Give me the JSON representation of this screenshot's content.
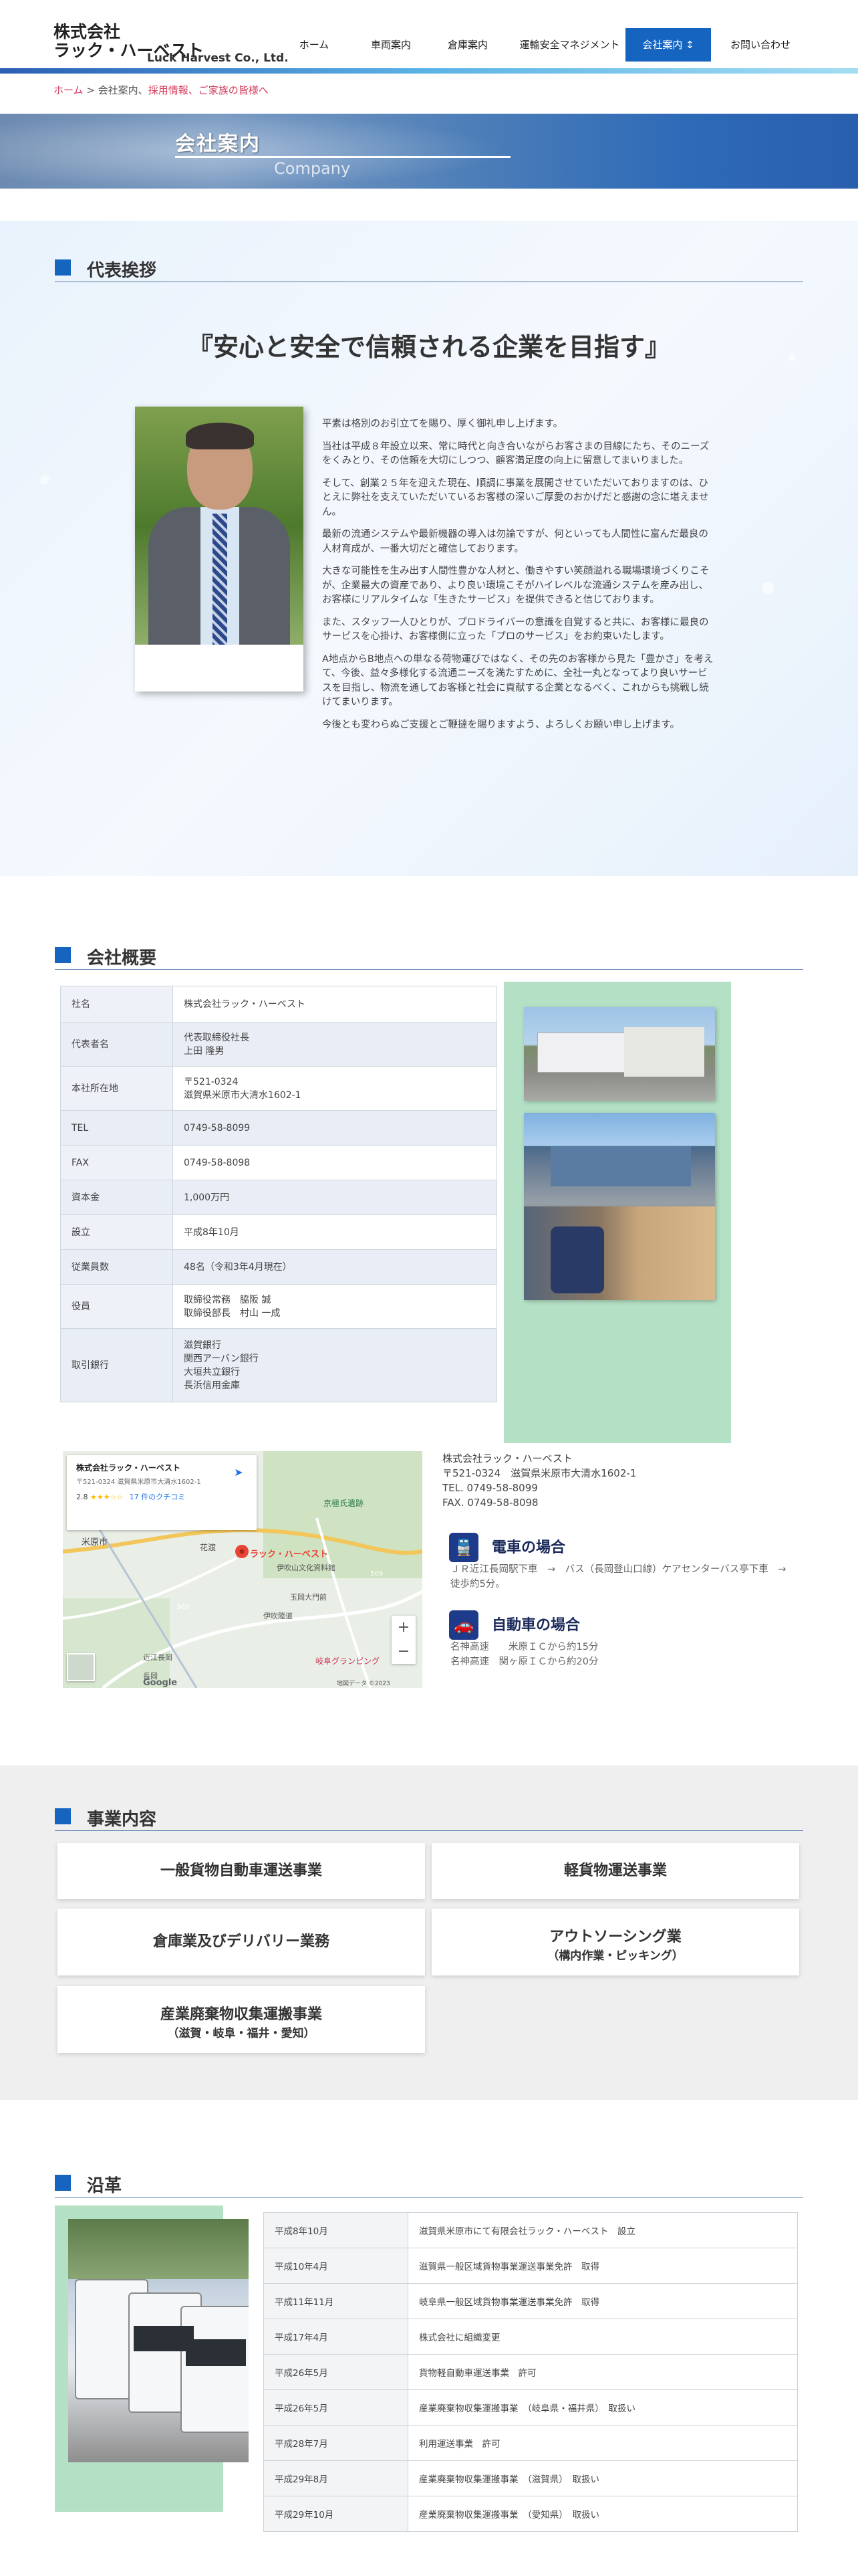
{
  "header": {
    "logo_line1": "株式会社",
    "logo_line2": "ラック・ハーベスト",
    "logo_en": "Luck Harvest Co., Ltd.",
    "nav": [
      {
        "label": "ホーム"
      },
      {
        "label": "車両案内"
      },
      {
        "label": "倉庫案内"
      },
      {
        "label": "運輸安全マネジメント"
      },
      {
        "label": "会社案内 ↕",
        "active": true
      },
      {
        "label": "お問い合わせ"
      }
    ]
  },
  "breadcrumb": {
    "home": "ホーム",
    "sep": " > ",
    "current": "会社案内、",
    "links": "採用情報、ご家族の皆様へ"
  },
  "hero": {
    "title": "会社案内",
    "subtitle": "Company"
  },
  "greeting": {
    "section_title": "代表挨拶",
    "motto": "『安心と安全で信頼される企業を目指す』",
    "paragraphs": [
      "平素は格別のお引立てを賜り、厚く御礼申し上げます。",
      "当社は平成８年設立以来、常に時代と向き合いながらお客さまの目線にたち、そのニーズをくみとり、その信頼を大切にしつつ、顧客満足度の向上に留意してまいりました。",
      "そして、創業２５年を迎えた現在、順調に事業を展開させていただいておりますのは、ひとえに弊社を支えていただいているお客様の深いご厚愛のおかげだと感謝の念に堪えません。",
      "最新の流通システムや最新機器の導入は勿論ですが、何といっても人間性に富んだ最良の人材育成が、一番大切だと確信しております。",
      "大きな可能性を生み出す人間性豊かな人材と、働きやすい笑顔溢れる職場環境づくりこそが、企業最大の資産であり、より良い環境こそがハイレベルな流通システムを産み出し、お客様にリアルタイムな「生きたサービス」を提供できると信じております。",
      "また、スタッフ一人ひとりが、プロドライバーの意識を自覚すると共に、お客様に最良のサービスを心掛け、お客様側に立った「プロのサービス」をお約束いたします。",
      "A地点からB地点への単なる荷物運びではなく、その先のお客様から見た「豊かさ」を考えて、今後、益々多様化する流通ニーズを満たすために、全社一丸となってより良いサービスを目指し、物流を通してお客様と社会に貢献する企業となるべく、これからも挑戦し続けてまいります。",
      "今後とも変わらぬご支援とご鞭撻を賜りますよう、よろしくお願い申し上げます。"
    ]
  },
  "company": {
    "section_title": "会社概要",
    "rows": [
      {
        "k": "社名",
        "v": [
          "株式会社ラック・ハーベスト"
        ]
      },
      {
        "k": "代表者名",
        "v": [
          "代表取締役社長",
          "上田 隆男"
        ]
      },
      {
        "k": "本社所在地",
        "v": [
          "〒521-0324",
          "滋賀県米原市大清水1602-1"
        ]
      },
      {
        "k": "TEL",
        "v": [
          "0749-58-8099"
        ]
      },
      {
        "k": "FAX",
        "v": [
          "0749-58-8098"
        ]
      },
      {
        "k": "資本金",
        "v": [
          "1,000万円"
        ]
      },
      {
        "k": "設立",
        "v": [
          "平成8年10月"
        ]
      },
      {
        "k": "従業員数",
        "v": [
          "48名（令和3年4月現在）"
        ]
      },
      {
        "k": "役員",
        "v": [
          "取締役常務　脇阪 誠",
          "取締役部長　村山 一成"
        ]
      },
      {
        "k": "取引銀行",
        "v": [
          "滋賀銀行",
          "関西アーバン銀行",
          "大垣共立銀行",
          "長浜信用金庫"
        ]
      }
    ],
    "address_lines": [
      "株式会社ラック・ハーベスト",
      "〒521-0324　滋賀県米原市大清水1602-1",
      "TEL. 0749-58-8099",
      "FAX. 0749-58-8098"
    ],
    "access": [
      {
        "icon": "train-icon",
        "title": "電車の場合",
        "desc": [
          "ＪＲ近江長岡駅下車　→　バス（長岡登山口線）ケアセンターバス亭下車　→　徒歩約5分。"
        ]
      },
      {
        "icon": "car-icon",
        "title": "自動車の場合",
        "desc": [
          "名神高速　　米原ＩＣから約15分",
          "名神高速　関ヶ原ＩＣから約20分"
        ]
      }
    ],
    "map": {
      "place_name": "株式会社ラック・ハーベスト",
      "place_addr": "〒521-0324 滋賀県米原市大清水1602-1",
      "rating": "2.8",
      "stars": "★★★☆☆",
      "reviews": "17 件のクチコミ",
      "marker_label": "ラック・ハーベスト",
      "labels": [
        "米原市",
        "花渡",
        "京極氏遺跡",
        "伊吹山文化資料館",
        "玉岡大門前",
        "伊吹陸道",
        "近江長岡",
        "岐阜グランピング",
        "長岡"
      ],
      "route_labels": [
        "365",
        "509"
      ],
      "google": "Google",
      "footer": "地図データ ©2023"
    }
  },
  "business": {
    "section_title": "事業内容",
    "items": [
      {
        "main": "一般貨物自動車運送事業",
        "sub": ""
      },
      {
        "main": "軽貨物運送事業",
        "sub": ""
      },
      {
        "main": "倉庫業及びデリバリー業務",
        "sub": ""
      },
      {
        "main": "アウトソーシング業",
        "sub": "（構内作業・ピッキング）"
      },
      {
        "main": "産業廃棄物収集運搬事業",
        "sub": "（滋賀・岐阜・福井・愛知）"
      }
    ]
  },
  "history": {
    "section_title": "沿革",
    "rows": [
      {
        "k": "平成8年10月",
        "v": "滋賀県米原市にて有限会社ラック・ハーベスト　設立"
      },
      {
        "k": "平成10年4月",
        "v": "滋賀県一般区域貨物事業運送事業免許　取得"
      },
      {
        "k": "平成11年11月",
        "v": "岐阜県一般区域貨物事業運送事業免許　取得"
      },
      {
        "k": "平成17年4月",
        "v": "株式会社に組織変更"
      },
      {
        "k": "平成26年5月",
        "v": "貨物軽自動車運送事業　許可"
      },
      {
        "k": "平成26年5月",
        "v": "産業廃棄物収集運搬事業　（岐阜県・福井県）　取扱い"
      },
      {
        "k": "平成28年7月",
        "v": "利用運送事業　許可"
      },
      {
        "k": "平成29年8月",
        "v": "産業廃棄物収集運搬事業　（滋賀県）　取扱い"
      },
      {
        "k": "平成29年10月",
        "v": "産業廃棄物収集運搬事業　（愛知県）　取扱い"
      }
    ]
  },
  "colors": {
    "brand_blue": "#1565c0",
    "green_block": "#b4e1c6",
    "crumb_pink": "#d23b5b"
  }
}
